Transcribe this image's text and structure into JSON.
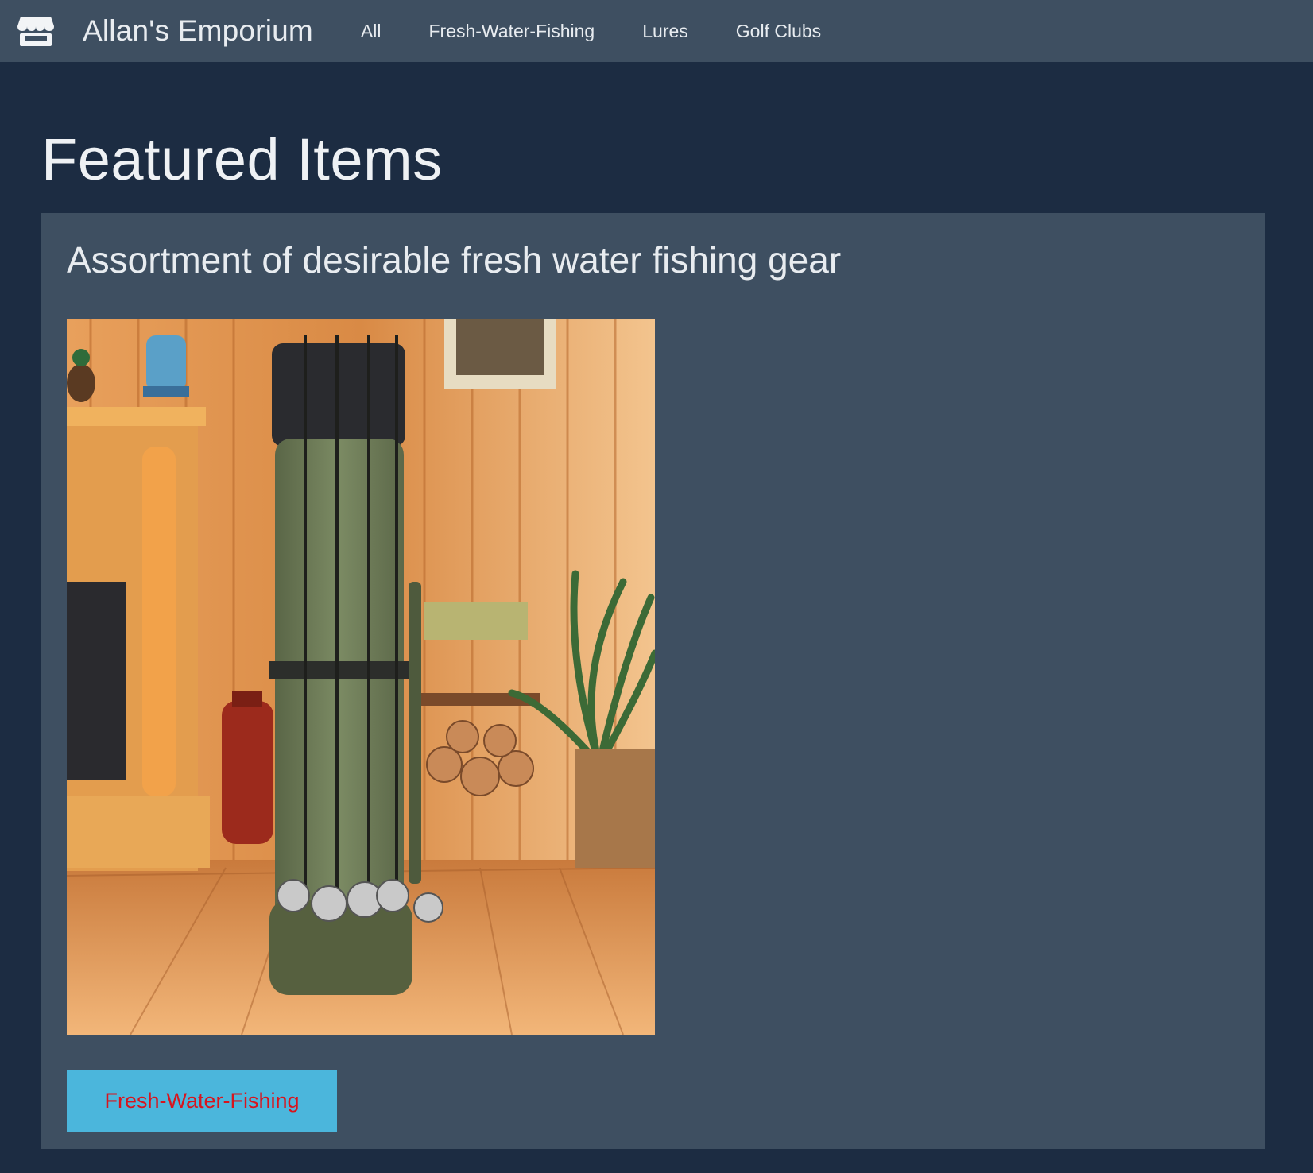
{
  "navbar": {
    "brand": {
      "icon": "store-icon",
      "name": "Allan's Emporium"
    },
    "links": [
      {
        "label": "All"
      },
      {
        "label": "Fresh-Water-Fishing"
      },
      {
        "label": "Lures"
      },
      {
        "label": "Golf Clubs"
      }
    ]
  },
  "main": {
    "title": "Featured Items",
    "featured": {
      "title": "Assortment of desirable fresh water fishing gear",
      "image": {
        "icon": "fishing-rod-bag-photo"
      },
      "category_button": "Fresh-Water-Fishing"
    }
  },
  "colors": {
    "page_background": "#1c2c42",
    "panel_background": "#3e4f61",
    "button_background": "#4bb6dc",
    "button_text": "#d8141d"
  }
}
